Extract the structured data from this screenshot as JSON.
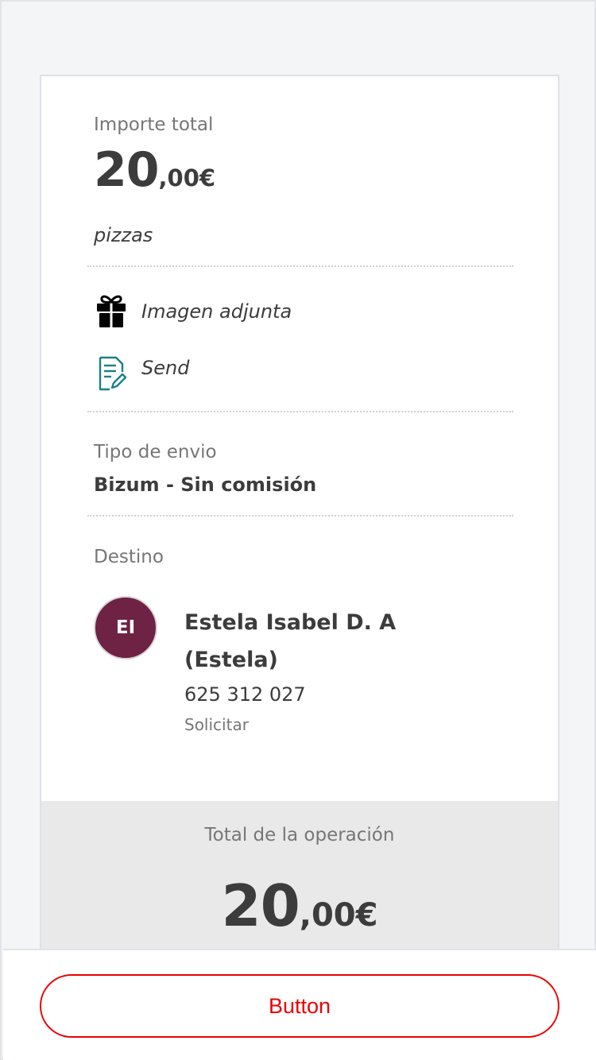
{
  "summary": {
    "amount_label": "Importe total",
    "amount_integer": "20",
    "amount_decimals": ",00€",
    "concept": "pizzas"
  },
  "extras": {
    "attachment": {
      "icon": "gift-icon",
      "label": "Imagen adjunta"
    },
    "note": {
      "icon": "note-edit-icon",
      "label": "Send"
    }
  },
  "shipping": {
    "label": "Tipo de envio",
    "value": "Bizum - Sin comisión"
  },
  "destination": {
    "label": "Destino",
    "contact": {
      "initials": "EI",
      "name": "Estela Isabel D. A (Estela)",
      "phone": "625 312 027",
      "action": "Solicitar"
    }
  },
  "total": {
    "label": "Total de la operación",
    "amount_integer": "20",
    "amount_decimals": ",00€"
  },
  "footer": {
    "button_label": "Button"
  },
  "colors": {
    "accent": "#ec0000",
    "avatar": "#6e2244",
    "teal_icon": "#1b7f86"
  }
}
